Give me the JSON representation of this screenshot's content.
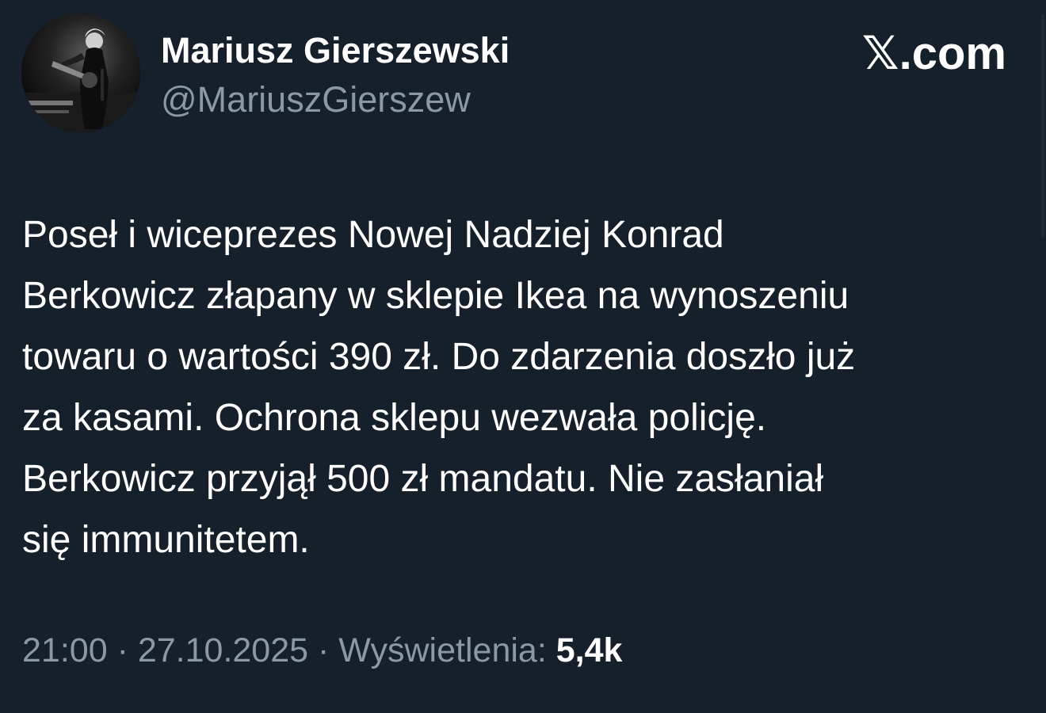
{
  "colors": {
    "background": "#15202b",
    "text_primary": "#ffffff",
    "text_secondary": "#8b98a5"
  },
  "author": {
    "display_name": "Mariusz Gierszewski",
    "handle": "@MariuszGierszew",
    "avatar_icon": "avatar-photo-guitarist-icon"
  },
  "brand": {
    "label": "𝕏.com"
  },
  "tweet": {
    "lines": [
      "Poseł i wiceprezes Nowej Nadziej Konrad",
      "Berkowicz złapany w sklepie Ikea na wynoszeniu",
      "towaru o wartości 390 zł. Do zdarzenia doszło już",
      "za kasami. Ochrona sklepu wezwała policję.",
      "Berkowicz przyjął 500 zł mandatu. Nie zasłaniał",
      "się immunitetem."
    ]
  },
  "meta": {
    "time": "21:00",
    "separator": "·",
    "date": "27.10.2025",
    "views_label": "Wyświetlenia:",
    "views_count": "5,4k"
  }
}
